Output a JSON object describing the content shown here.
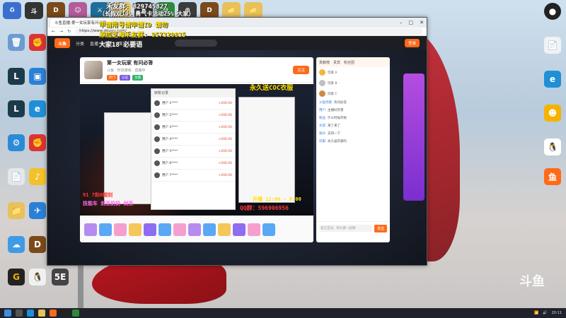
{
  "overlay": {
    "qq_line": "禾友群: 829745827",
    "mid_line": "（长假双10%  勇气卡活动25%  大家）",
    "apply_line": "申请用号请申请ID 请勿",
    "add_line": "添加芝海禾友群: 957320835",
    "side_right": "大家18 必要语",
    "banner": "永久送COC衣服",
    "play_time": "开播 12:00 ~ 0:00",
    "qq_id": "QQ群：596906956",
    "left_red": "91 7和6帽刻",
    "left_red2": "技能车 剑圣奶奶 剑圣"
  },
  "browser": {
    "tab_title": "斗鱼直播-第一女玩家有问必答",
    "url": "https://www.douyu.com/",
    "nav_items": [
      "分类",
      "直播",
      "游戏",
      "赛事"
    ],
    "login": "登录"
  },
  "room": {
    "title": "第一女玩家 有问必答",
    "subtitle": "斗鱼 · 怀旧游戏 · 直播中",
    "tags": [
      "热门",
      "认证",
      "主播"
    ],
    "follow": "关注"
  },
  "phone": {
    "header": "转账记录",
    "rows": [
      {
        "name": "用户 1****",
        "amount": "+200.00"
      },
      {
        "name": "用户 2****",
        "amount": "+200.00"
      },
      {
        "name": "用户 3****",
        "amount": "+200.00"
      },
      {
        "name": "用户 4****",
        "amount": "+200.00"
      },
      {
        "name": "用户 5****",
        "amount": "+200.00"
      },
      {
        "name": "用户 6****",
        "amount": "+200.00"
      },
      {
        "name": "用户 7****",
        "amount": "+200.00"
      }
    ]
  },
  "side": {
    "tabs": [
      "贡献榜",
      "贵宾",
      "粉丝团"
    ],
    "rank": [
      {
        "name": "玩家 A"
      },
      {
        "name": "玩家 B"
      },
      {
        "name": "玩家 C"
      }
    ],
    "messages": [
      {
        "user": "斗鱼玩家:",
        "text": "有问必答"
      },
      {
        "user": "用户:",
        "text": "主播好厉害"
      },
      {
        "user": "粉丝:",
        "text": "什么时候开始"
      },
      {
        "user": "水友:",
        "text": "来了来了"
      },
      {
        "user": "观众:",
        "text": "支持一下"
      },
      {
        "user": "玩家:",
        "text": "永久送衣服吗"
      }
    ],
    "input_placeholder": "发言互动，和大家一起聊",
    "send": "发送"
  },
  "watermark": "斗鱼",
  "taskbar": {
    "time": "20:11"
  }
}
